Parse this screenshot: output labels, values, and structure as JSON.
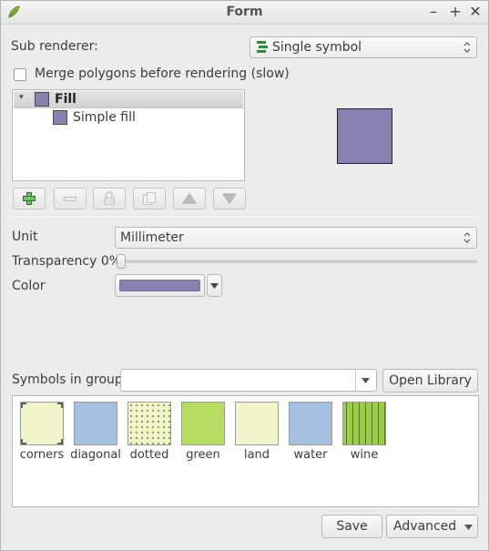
{
  "window": {
    "title": "Form"
  },
  "sub_renderer": {
    "label": "Sub renderer:",
    "value": "Single symbol"
  },
  "merge": {
    "label": "Merge polygons before rendering (slow)",
    "checked": false
  },
  "layers": [
    {
      "label": "Fill",
      "bold": true
    },
    {
      "label": "Simple fill",
      "bold": false
    }
  ],
  "symbol_color": "#8a80b0",
  "unit": {
    "label": "Unit",
    "value": "Millimeter"
  },
  "transparency": {
    "label": "Transparency 0%",
    "value_percent": 0
  },
  "color": {
    "label": "Color",
    "value": "#8a80b0"
  },
  "symbols_group": {
    "label": "Symbols in group",
    "value": "",
    "open_library_label": "Open Library"
  },
  "symbols": [
    {
      "name": "corners",
      "fill": "#f1f4cb",
      "pattern": "corners"
    },
    {
      "name": "diagonal",
      "fill": "#a7c0e0",
      "pattern": "plain"
    },
    {
      "name": "dotted",
      "fill": "#f1f4cb",
      "pattern": "dots"
    },
    {
      "name": "green",
      "fill": "#b6dd62",
      "pattern": "plain"
    },
    {
      "name": "land",
      "fill": "#f1f4cb",
      "pattern": "plain"
    },
    {
      "name": "water",
      "fill": "#a7c0e0",
      "pattern": "plain"
    },
    {
      "name": "wine",
      "fill": "#9ccc4a",
      "pattern": "dashes"
    }
  ],
  "footer": {
    "save_label": "Save",
    "advanced_label": "Advanced"
  }
}
